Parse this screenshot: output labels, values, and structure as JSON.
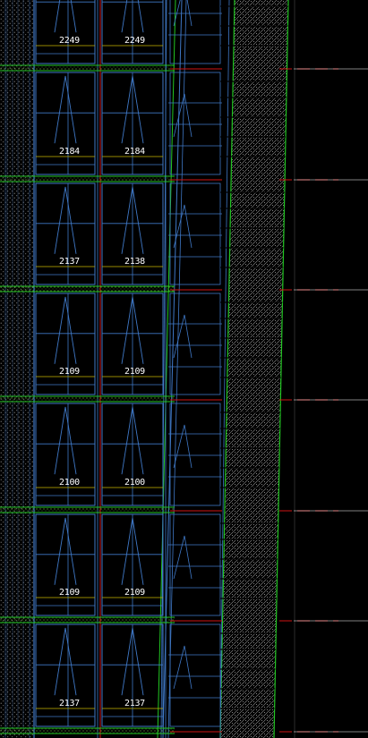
{
  "colors": {
    "background": "#000000",
    "frame": "#3f78c6",
    "green": "#22c622",
    "red": "#d01414",
    "white": "#ffffff",
    "yellow": "#c8b400",
    "hatch": "#9a9a9a"
  },
  "floors": [
    {
      "labels": [
        "2249",
        "2249"
      ]
    },
    {
      "labels": [
        "2184",
        "2184"
      ]
    },
    {
      "labels": [
        "2137",
        "2138"
      ]
    },
    {
      "labels": [
        "2109",
        "2109"
      ]
    },
    {
      "labels": [
        "2100",
        "2100"
      ]
    },
    {
      "labels": [
        "2109",
        "2109"
      ]
    },
    {
      "labels": [
        "2137",
        "2137"
      ]
    }
  ]
}
